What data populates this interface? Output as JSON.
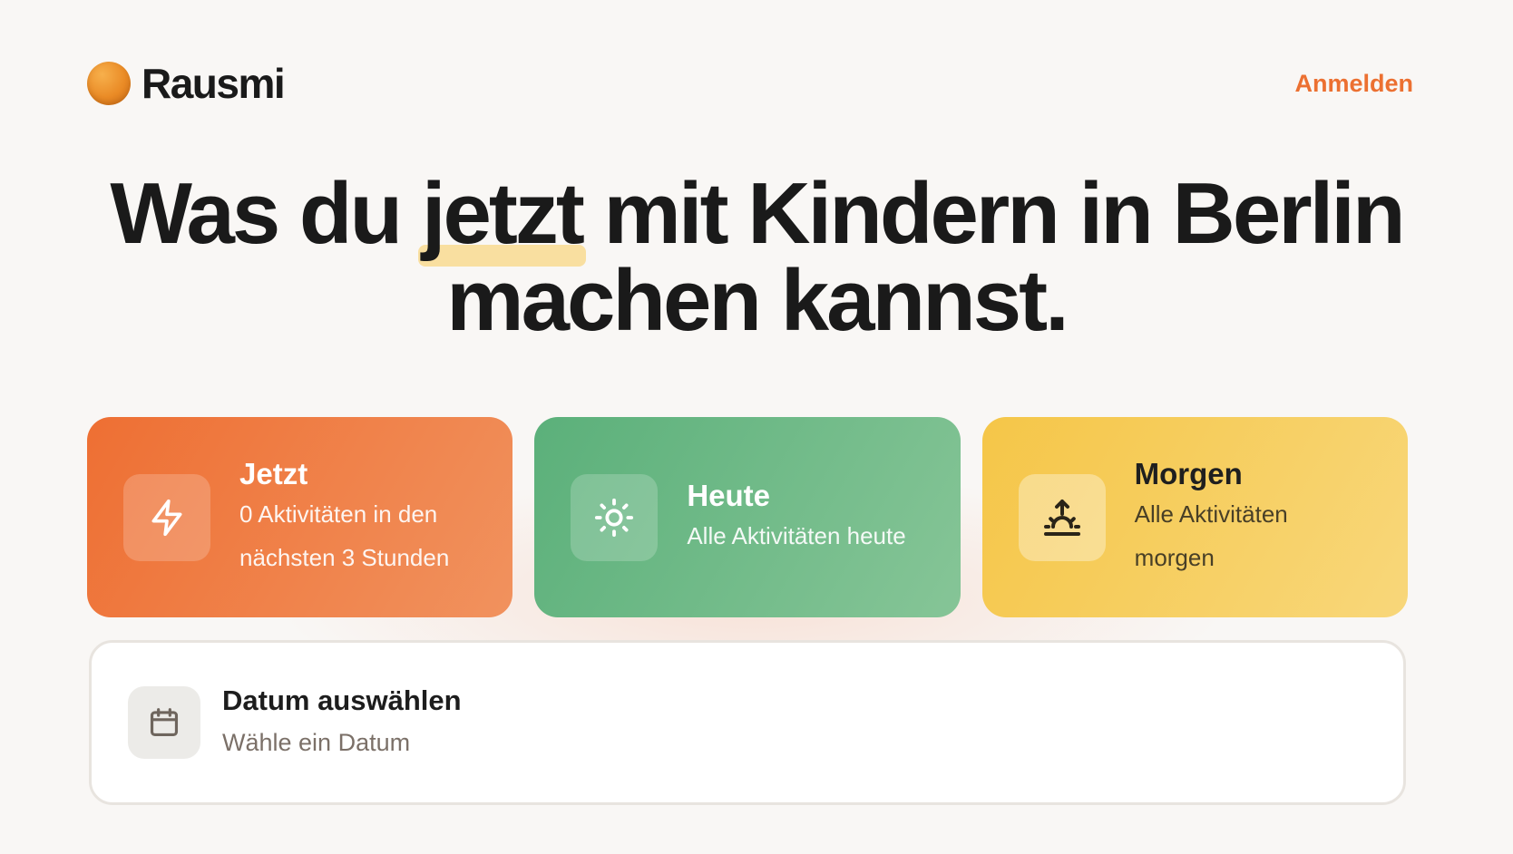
{
  "brand": {
    "name": "Rausmi"
  },
  "header": {
    "login_label": "Anmelden"
  },
  "hero": {
    "line1_before": "Was du ",
    "line1_highlight": "jetzt",
    "line1_after": " mit Kindern in Berlin",
    "line2": "machen kannst."
  },
  "cards": [
    {
      "title": "Jetzt",
      "description": "0 Aktivitäten in den nächsten 3 Stunden",
      "icon": "lightning-icon",
      "color": "#ee6f33"
    },
    {
      "title": "Heute",
      "description": "Alle Aktivitäten heute",
      "icon": "sun-icon",
      "color": "#5bb07a"
    },
    {
      "title": "Morgen",
      "description": "Alle Aktivitäten morgen",
      "icon": "sunrise-icon",
      "color": "#f5c648"
    }
  ],
  "date_picker": {
    "title": "Datum auswählen",
    "subtitle": "Wähle ein Datum",
    "icon": "calendar-icon"
  },
  "colors": {
    "accent": "#ec7031",
    "background": "#f9f7f5",
    "highlight": "#f9dfa0"
  }
}
